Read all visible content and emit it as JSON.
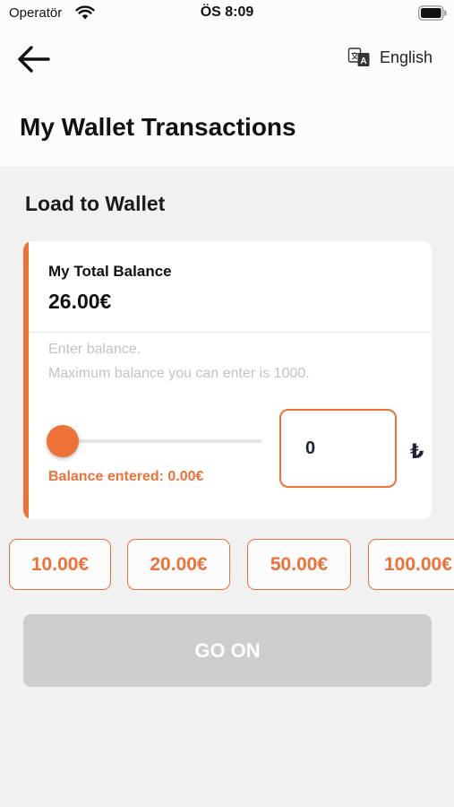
{
  "status_bar": {
    "carrier": "Operatör",
    "time": "ÖS 8:09"
  },
  "header": {
    "language": "English",
    "title": "My Wallet Transactions"
  },
  "section": {
    "title": "Load to Wallet"
  },
  "balance_card": {
    "total_label": "My Total Balance",
    "total_value": "26.00€",
    "hint_line1": "Enter balance.",
    "hint_line2": "Maximum balance you can enter is 1000.",
    "slider_fraction": 0,
    "amount_value": "0",
    "currency_symbol": "₺",
    "entered_text": "Balance entered: 0.00€"
  },
  "quick_amounts": [
    "10.00€",
    "20.00€",
    "50.00€",
    "100.00€"
  ],
  "go_button": "GO ON",
  "colors": {
    "accent": "#ee7137",
    "disabled_button": "#cdcdcd",
    "background": "#f1f1f1"
  }
}
